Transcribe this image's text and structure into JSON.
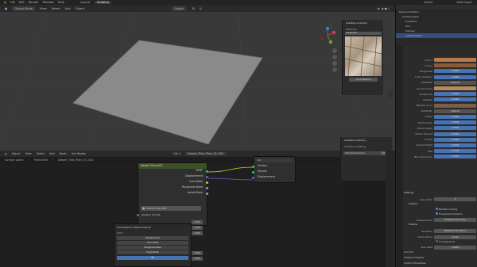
{
  "topbar": {
    "menus": [
      "File",
      "Edit",
      "Render",
      "Window",
      "Help"
    ],
    "tabs": [
      "Layout",
      "Shading"
    ],
    "active_tab": "Shading",
    "scene_label": "Scene",
    "view_layer_label": "View Layer"
  },
  "viewport_header": {
    "mode": "Object Mode",
    "menus": [
      "View",
      "Select",
      "Add",
      "Object"
    ],
    "transform": "Global"
  },
  "substance_library_panel": {
    "title": "Substance Library",
    "section": "Materials",
    "dropdown": "Substrates",
    "apply_button": "Apply Material"
  },
  "node_header": {
    "mode": "Object",
    "menus": [
      "View",
      "Select",
      "Add",
      "Node"
    ],
    "use_nodes": "Use Nodes",
    "slot": "Slot 1",
    "material": "Desert_Tiles_Plain_01_002"
  },
  "breadcrumb": [
    "Surface plane",
    "Plane.006",
    "Desert_Tiles_Plain_01_002"
  ],
  "node_main": {
    "title": "Desert Tiles.002",
    "outputs": [
      "BSDF",
      "Displacement",
      "Color Bake",
      "Roughness Bake",
      "Height Bake"
    ],
    "datablock": "Desert Tiles.002",
    "input": "Replace Coords."
  },
  "node_output": {
    "target": "All",
    "inputs": [
      "Surface",
      "Volume",
      "Displacement"
    ]
  },
  "bake_popup": {
    "title": "Set Substance Bake Outputs",
    "subtitle": "BSDF",
    "rows": [
      "Displacement",
      "Color Bake",
      "Roughness Bake",
      "Height Bake"
    ],
    "ok": "OK",
    "values": [
      "2048",
      "2048",
      "2048",
      "2048",
      "2048"
    ]
  },
  "node_sidebar": {
    "title": "Substance Library",
    "section": "Substance Baking",
    "field_label": "Textures Resolution",
    "field_value": "512"
  },
  "outliner": {
    "root": "Scene Collection",
    "items": [
      "Surface plane",
      "Collection",
      "Sun",
      "Camera",
      "Surface plane"
    ]
  },
  "properties": {
    "rows": [
      {
        "label": "Color1",
        "value": "",
        "style": "swatch"
      },
      {
        "label": "Color2",
        "value": "",
        "style": "swatch"
      },
      {
        "label": "Roughness",
        "value": "0.0000",
        "style": "blue"
      },
      {
        "label": "Color Variation",
        "value": "0.2000",
        "style": "blue"
      },
      {
        "label": "-GROUND-",
        "value": "Default",
        "style": "plain"
      },
      {
        "label": "Ground Color",
        "value": "",
        "style": "swatch"
      },
      {
        "label": "Roughness",
        "value": "0.5000",
        "style": "blue"
      },
      {
        "label": "Pebbles",
        "value": "0.0000",
        "style": "blue"
      },
      {
        "label": "Pebbles Color",
        "value": "",
        "style": "swatch"
      },
      {
        "label": "-DAMAGE-",
        "value": "Default",
        "style": "plain"
      },
      {
        "label": "Dents",
        "value": "1.0000",
        "style": "blue"
      },
      {
        "label": "Dents Scale",
        "value": "1.0000",
        "style": "blue"
      },
      {
        "label": "Dents Height",
        "value": "0.5000",
        "style": "blue"
      },
      {
        "label": "Dents Amount",
        "value": "0.5000",
        "style": "blue"
      },
      {
        "label": "Cracks",
        "value": "1.0000",
        "style": "blue"
      },
      {
        "label": "Cracks Height",
        "value": "0.5000",
        "style": "blue"
      },
      {
        "label": "Size",
        "value": "1.0000",
        "style": "blue"
      },
      {
        "label": "Blur Resolution",
        "value": "0.7000",
        "style": "blue"
      }
    ],
    "settings_title": "Settings",
    "pass_index_label": "Pass Index",
    "pass_index": "0",
    "surface_title": "Surface",
    "checkboxes": [
      "Backface Culling",
      "Transparent Shadows"
    ],
    "displacement_label": "Displacement",
    "displacement_value": "Displacement Only",
    "volume_title": "Volume",
    "sampling_label": "Sampling",
    "sampling_value": "Multiple Importance",
    "interpolation_label": "Interpolation",
    "interpolation_value": "Linear",
    "homogeneous_label": "Homogeneous",
    "step_rate_label": "Step Rate",
    "step_rate": "1.0000",
    "collapsed": [
      "Line Art",
      "Viewport Display",
      "Custom Properties"
    ]
  },
  "colors": {
    "accent_blue": "#4772b3",
    "node_header_green": "#3b5226",
    "socket_yellow": "#c7c729",
    "socket_purple": "#6363c7"
  }
}
